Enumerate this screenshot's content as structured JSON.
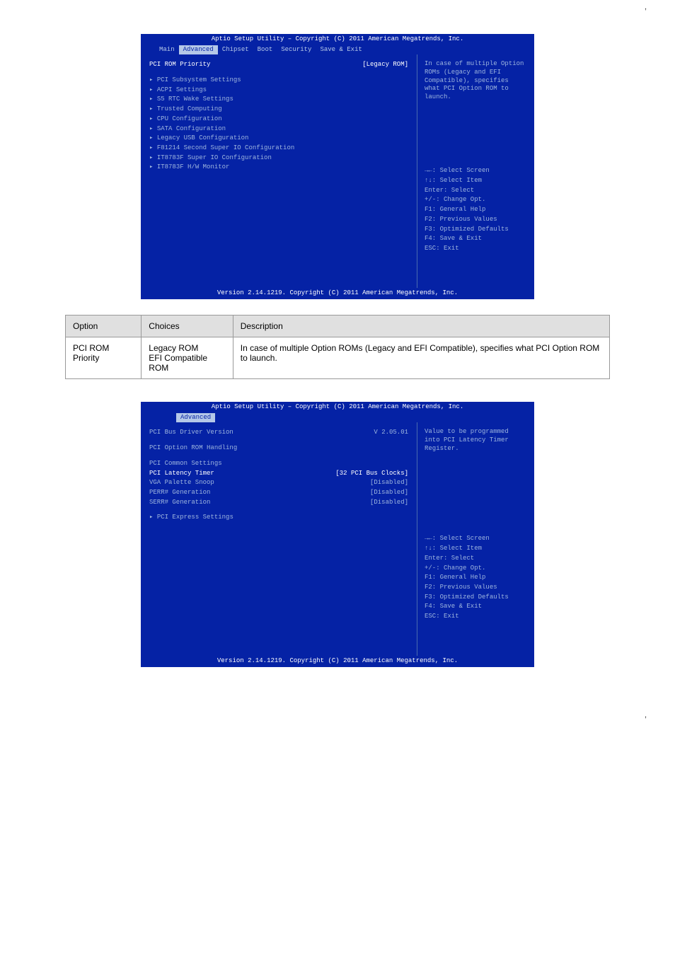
{
  "page_top_marker": ",",
  "bios1": {
    "title": "Aptio Setup Utility – Copyright (C) 2011 American Megatrends, Inc.",
    "tabs": [
      "Main",
      "Advanced",
      "Chipset",
      "Boot",
      "Security",
      "Save & Exit"
    ],
    "active_tab_index": 1,
    "selected": {
      "label": "PCI ROM Priority",
      "value": "[Legacy ROM]"
    },
    "submenus": [
      "PCI Subsystem Settings",
      "ACPI Settings",
      "S5 RTC Wake Settings",
      "Trusted Computing",
      "CPU Configuration",
      "SATA Configuration",
      "Legacy USB Configuration",
      "F81214 Second Super IO Configuration",
      "IT8783F Super IO Configuration",
      "IT8783F H/W Monitor"
    ],
    "help": "In case of multiple Option ROMs (Legacy and EFI Compatible), specifies what PCI Option ROM to launch.",
    "legend": [
      "→←: Select Screen",
      "↑↓: Select Item",
      "Enter: Select",
      "+/-: Change Opt.",
      "F1: General Help",
      "F2: Previous Values",
      "F3: Optimized Defaults",
      "F4: Save & Exit",
      "ESC: Exit"
    ],
    "footer": "Version 2.14.1219. Copyright (C) 2011 American Megatrends, Inc."
  },
  "table1": {
    "headers": [
      "Option",
      "Choices",
      "Description"
    ],
    "rows": [
      {
        "option": "PCI ROM Priority",
        "choices": "Legacy ROM\nEFI Compatible ROM",
        "description": "In case of multiple Option ROMs (Legacy and EFI Compatible), specifies what PCI Option ROM to launch."
      }
    ]
  },
  "bios2": {
    "title": "Aptio Setup Utility – Copyright (C) 2011 American Megatrends, Inc.",
    "active_tab": "Advanced",
    "top_rows": [
      {
        "label": "PCI Bus Driver Version",
        "value": "V 2.05.01"
      },
      {
        "label": "PCI Option ROM Handling",
        "value": ""
      }
    ],
    "section_title": "PCI Common Settings",
    "settings": [
      {
        "label": "PCI Latency Timer",
        "value": "[32 PCI Bus Clocks]"
      },
      {
        "label": "VGA Palette Snoop",
        "value": "[Disabled]"
      },
      {
        "label": "PERR# Generation",
        "value": "[Disabled]"
      },
      {
        "label": "SERR# Generation",
        "value": "[Disabled]"
      }
    ],
    "submenus": [
      "PCI Express Settings"
    ],
    "help": "Value to be programmed into PCI Latency Timer Register.",
    "legend": [
      "→←: Select Screen",
      "↑↓: Select Item",
      "Enter: Select",
      "+/-: Change Opt.",
      "F1: General Help",
      "F2: Previous Values",
      "F3: Optimized Defaults",
      "F4: Save & Exit",
      "ESC: Exit"
    ],
    "footer": "Version 2.14.1219. Copyright (C) 2011 American Megatrends, Inc."
  },
  "page_bottom_marker": ","
}
